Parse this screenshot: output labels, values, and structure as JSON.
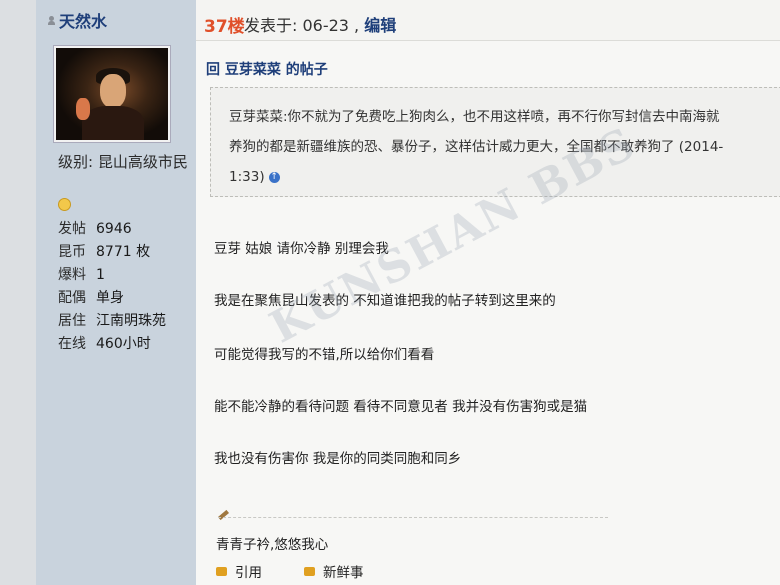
{
  "user": {
    "name": "天然水",
    "level": "级别: 昆山高级市民",
    "stats": [
      {
        "key": "发帖",
        "value": "6946"
      },
      {
        "key": "昆币",
        "value": "8771 枚"
      },
      {
        "key": "爆料",
        "value": "1"
      },
      {
        "key": "配偶",
        "value": "单身"
      },
      {
        "key": "居住",
        "value": "江南明珠苑"
      },
      {
        "key": "在线",
        "value": "460小时"
      }
    ]
  },
  "post": {
    "floor": "37楼",
    "meta": "发表于: 06-23 , ",
    "edit": "编辑",
    "reply_title": "回 豆芽菜菜 的帖子",
    "quote_lines": [
      "豆芽菜菜:你不就为了免费吃上狗肉么，也不用这样喷，再不行你写封信去中南海就",
      "养狗的都是新疆维族的恐、暴份子，这样估计威力更大，全国都不敢养狗了 (2014-",
      "1:33)"
    ],
    "content_lines": [
      "豆芽  姑娘  请你冷静   别理会我",
      "我是在聚焦昆山发表的  不知道谁把我的帖子转到这里来的",
      "可能觉得我写的不错,所以给你们看看",
      "能不能冷静的看待问题  看待不同意见者   我并没有伤害狗或是猫",
      "我也没有伤害你  我是你的同类同胞和同乡"
    ],
    "signature": "青青子衿,悠悠我心",
    "actions": {
      "quote_label": "引用",
      "fresh_label": "新鲜事"
    }
  },
  "watermark": "KUNSHAN BBS"
}
